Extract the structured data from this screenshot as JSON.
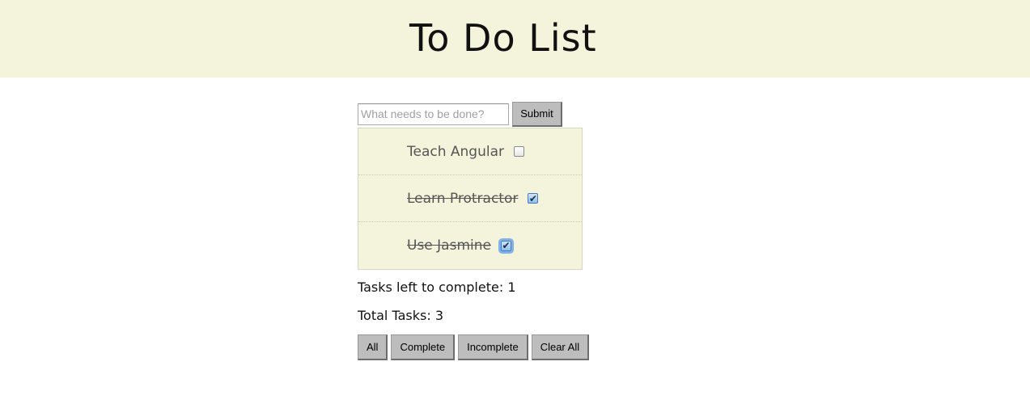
{
  "header": {
    "title": "To Do List"
  },
  "entry": {
    "placeholder": "What needs to be done?",
    "submit_label": "Submit"
  },
  "tasks": [
    {
      "label": "Teach Angular",
      "done": false
    },
    {
      "label": "Learn Protractor",
      "done": true
    },
    {
      "label": "Use Jasmine",
      "done": true
    }
  ],
  "stats": {
    "left_label": "Tasks left to complete:",
    "left_count": "1",
    "total_label": "Total Tasks:",
    "total_count": "3"
  },
  "filters": {
    "all_label": "All",
    "complete_label": "Complete",
    "incomplete_label": "Incomplete",
    "clear_label": "Clear All"
  },
  "colors": {
    "header_bg": "#f4f4dc",
    "list_bg": "#f4f4dc",
    "button_bg": "#bdbdbd"
  }
}
